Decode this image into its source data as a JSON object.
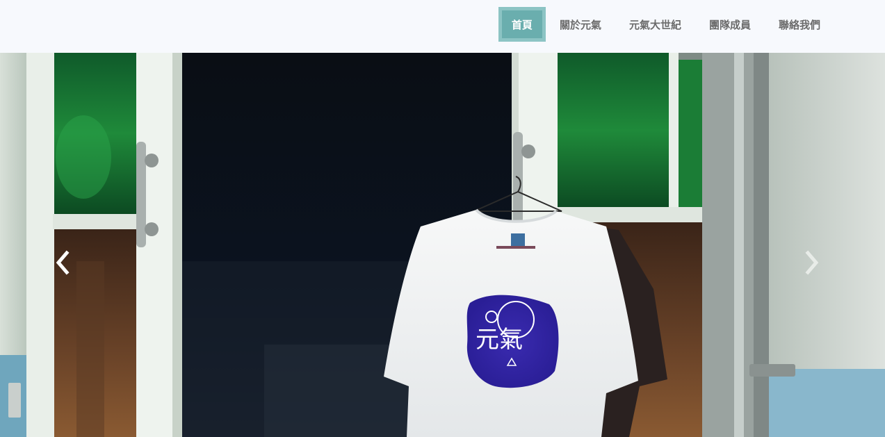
{
  "nav": {
    "items": [
      {
        "label": "首頁",
        "active": true
      },
      {
        "label": "關於元氣",
        "active": false
      },
      {
        "label": "元氣大世紀",
        "active": false
      },
      {
        "label": "團隊成員",
        "active": false
      },
      {
        "label": "聯絡我們",
        "active": false
      }
    ],
    "active_color": "#6aaeae"
  },
  "carousel": {
    "prev_icon": "chevron-left-icon",
    "next_icon": "chevron-right-icon",
    "slide": {
      "print_text": "元氣"
    }
  }
}
